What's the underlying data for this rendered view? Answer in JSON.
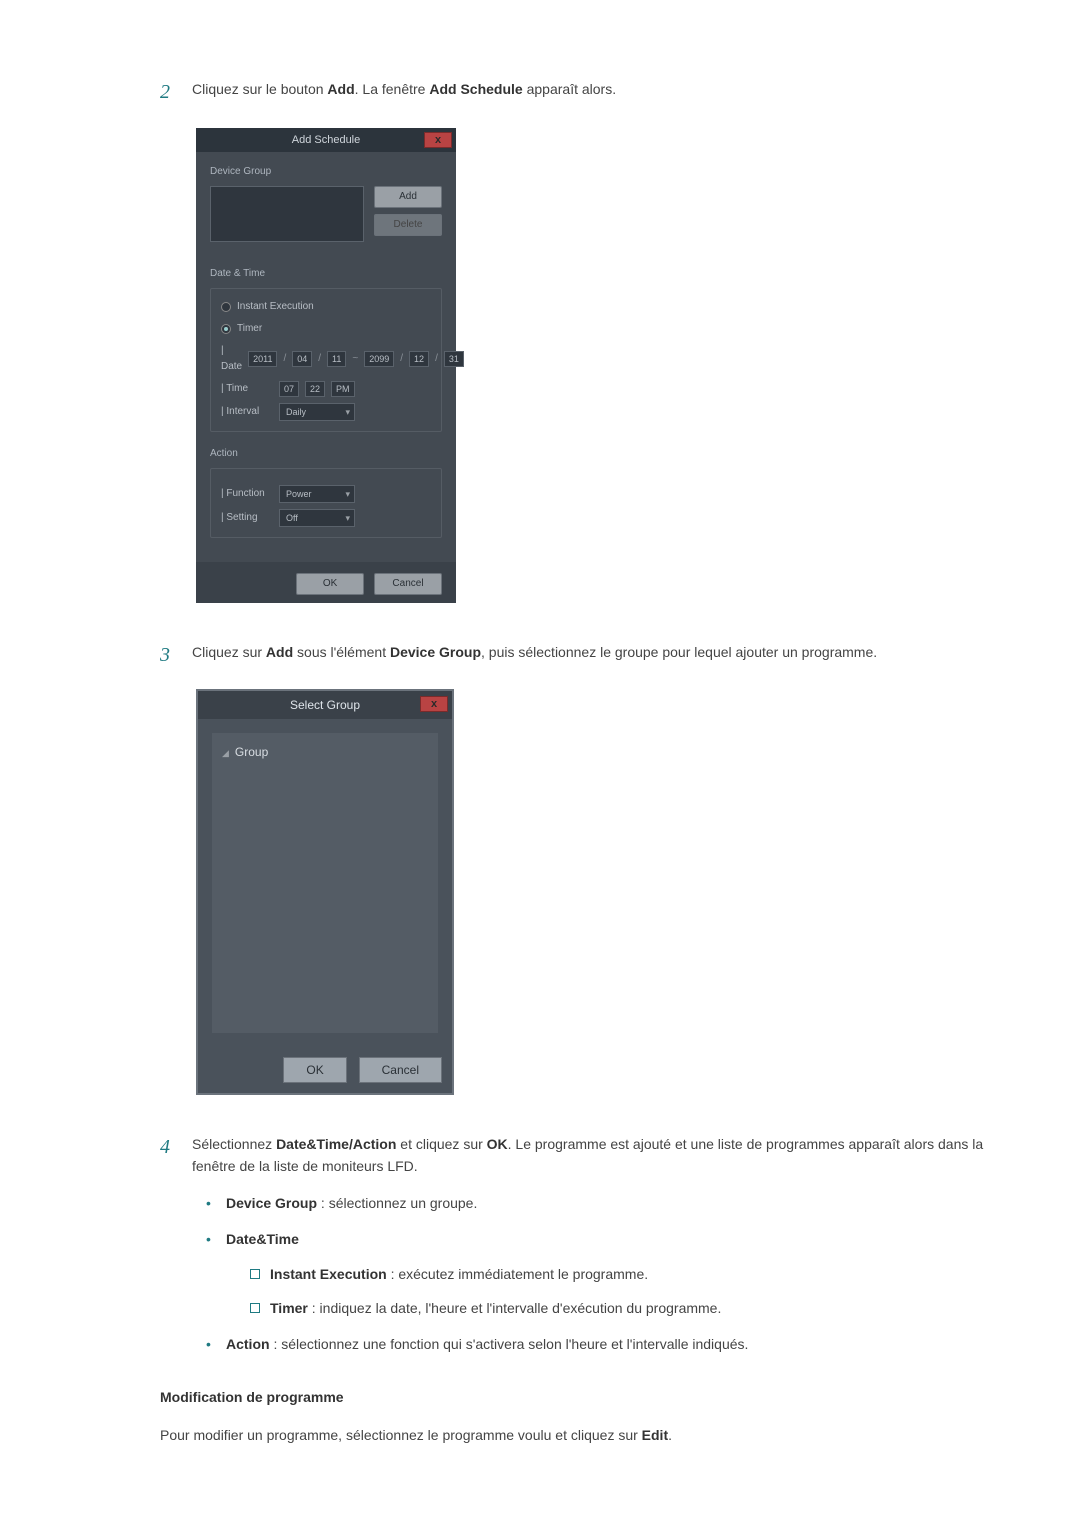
{
  "step2_text_parts": {
    "before_add": "Cliquez sur le bouton ",
    "add": "Add",
    "between": ". La fenêtre ",
    "add_schedule": "Add Schedule",
    "after": " apparaît alors."
  },
  "step2_num": "2",
  "add_schedule_dialog": {
    "title": "Add Schedule",
    "close": "x",
    "device_group_label": "Device Group",
    "add_btn": "Add",
    "delete_btn": "Delete",
    "date_time_label": "Date & Time",
    "instant_exec": "Instant Execution",
    "timer_label": "Timer",
    "row_date_label": "| Date",
    "date_y1": "2011",
    "date_m1": "04",
    "date_d1": "11",
    "tilde": "~",
    "date_y2": "2099",
    "date_m2": "12",
    "date_d2": "31",
    "row_time_label": "| Time",
    "time_h": "07",
    "time_m": "22",
    "time_ampm": "PM",
    "row_interval_label": "| Interval",
    "interval_val": "Daily",
    "action_label": "Action",
    "row_function_label": "| Function",
    "function_val": "Power",
    "row_setting_label": "| Setting",
    "setting_val": "Off",
    "ok": "OK",
    "cancel": "Cancel"
  },
  "step3_num": "3",
  "step3_parts": {
    "before_add": "Cliquez sur ",
    "add": "Add",
    "between1": " sous l'élément ",
    "device_group": "Device Group",
    "after": ", puis sélectionnez le groupe pour lequel ajouter un programme."
  },
  "select_group_dialog": {
    "title": "Select Group",
    "close": "x",
    "root_node": "Group",
    "ok": "OK",
    "cancel": "Cancel"
  },
  "step4_num": "4",
  "step4_parts": {
    "before": "Sélectionnez ",
    "dta": "Date&Time/Action",
    "between": " et cliquez sur ",
    "ok": "OK",
    "after": ". Le programme est ajouté et une liste de programmes apparaît alors dans la fenêtre de la liste de moniteurs LFD."
  },
  "bullets": {
    "device_group_label": "Device Group",
    "device_group_text": " : sélectionnez un groupe.",
    "date_time_label": "Date&Time",
    "instant_label": "Instant Execution",
    "instant_text": " : exécutez immédiatement le programme.",
    "timer_label": "Timer",
    "timer_text": " : indiquez la date, l'heure et l'intervalle d'exécution du programme.",
    "action_label": "Action",
    "action_text": " : sélectionnez une fonction qui s'activera selon l'heure et l'intervalle indiqués."
  },
  "mod_heading": "Modification de programme",
  "mod_para_parts": {
    "before": "Pour modifier un programme, sélectionnez le programme voulu et cliquez sur ",
    "edit": "Edit",
    "after": "."
  }
}
